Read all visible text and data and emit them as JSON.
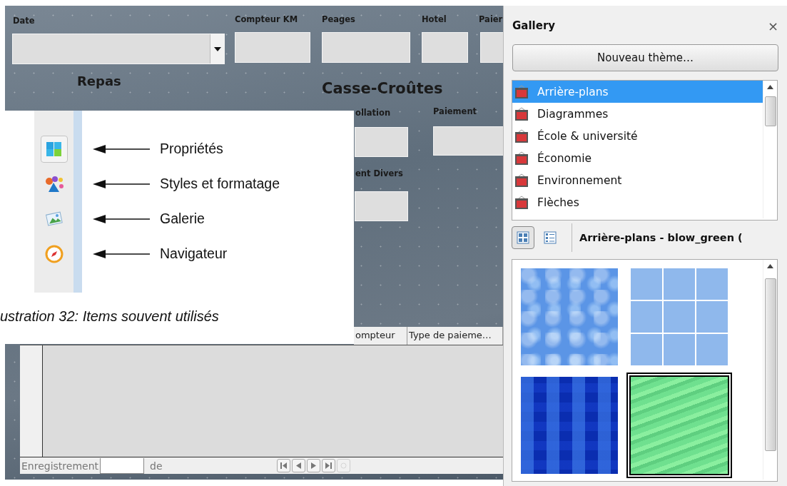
{
  "form": {
    "fields": [
      {
        "label": "Date",
        "kind": "combo"
      },
      {
        "label": "Compteur KM",
        "kind": "text"
      },
      {
        "label": "Peages",
        "kind": "text"
      },
      {
        "label": "Hotel",
        "kind": "text"
      },
      {
        "label": "Paier",
        "kind": "text"
      }
    ],
    "headings": [
      "Repas",
      "Casse-Croûtes"
    ],
    "lower_fields": [
      {
        "label": "ollation"
      },
      {
        "label": "Paiement"
      },
      {
        "label": "ent Divers"
      }
    ],
    "table": {
      "columns": [
        "ompteur",
        "Type de paieme…"
      ]
    },
    "navigator": {
      "record_label": "Enregistrement",
      "of_label": "de"
    }
  },
  "callout": {
    "items": [
      {
        "label": "Propriétés",
        "kind": "properties",
        "selected": true
      },
      {
        "label": "Styles et formatage",
        "kind": "styles",
        "selected": false
      },
      {
        "label": "Galerie",
        "kind": "gallery",
        "selected": false
      },
      {
        "label": "Navigateur",
        "kind": "navigator",
        "selected": false
      }
    ],
    "caption": "ustration 32: Items souvent utilisés"
  },
  "gallery": {
    "title": "Gallery",
    "close": "×",
    "new_theme_button": "Nouveau thème…",
    "themes": [
      {
        "label": "Arrière-plans",
        "selected": true
      },
      {
        "label": "Diagrammes",
        "selected": false
      },
      {
        "label": "École & université",
        "selected": false
      },
      {
        "label": "Économie",
        "selected": false
      },
      {
        "label": "Environnement",
        "selected": false
      },
      {
        "label": "Flèches",
        "selected": false
      }
    ],
    "view_modes": [
      {
        "kind": "icons",
        "selected": true
      },
      {
        "kind": "details",
        "selected": false
      }
    ],
    "current": "Arrière-plans - blow_green (",
    "thumbnails": [
      {
        "kind": "water",
        "selected": false
      },
      {
        "kind": "tiles",
        "selected": false
      },
      {
        "kind": "mosaic",
        "selected": false
      },
      {
        "kind": "marble",
        "selected": true
      }
    ]
  }
}
